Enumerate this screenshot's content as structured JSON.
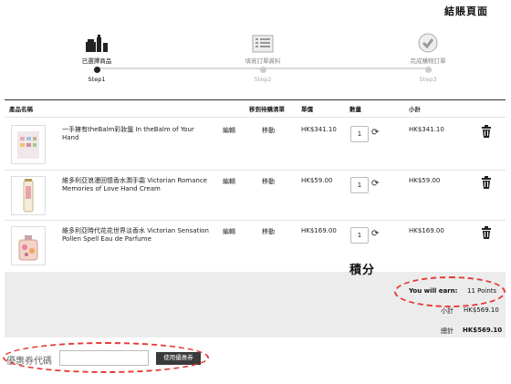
{
  "corner_note": "結賬頁面",
  "steps": [
    {
      "label": "已選擇商品",
      "num": "Step1",
      "icon": "products-icon",
      "active": true
    },
    {
      "label": "填寫訂單資料",
      "num": "Step2",
      "icon": "form-icon",
      "active": false
    },
    {
      "label": "完成購物訂單",
      "num": "Step3",
      "icon": "checkmark-icon",
      "active": false
    }
  ],
  "table": {
    "headers": {
      "name": "產品名稱",
      "wishlist": "移到待購清單",
      "price": "單價",
      "qty": "數量",
      "subtotal": "小計"
    },
    "rows": [
      {
        "name": "一手擁有theBalm彩妝盤 In theBalm of Your Hand",
        "edit": "編輯",
        "move": "移動",
        "price": "HK$341.10",
        "qty": "1",
        "subtotal": "HK$341.10"
      },
      {
        "name": "維多利亞浪漫回憶香水潤手霜 Victorian Romance Memories of Love Hand Cream",
        "edit": "編輯",
        "move": "移動",
        "price": "HK$59.00",
        "qty": "1",
        "subtotal": "HK$59.00"
      },
      {
        "name": "維多利亞時代花花世界淡香水 Victorian Sensation Pollen Spell Eau de Parfume",
        "edit": "編輯",
        "move": "移動",
        "price": "HK$169.00",
        "qty": "1",
        "subtotal": "HK$169.00"
      }
    ]
  },
  "points_note": "積分",
  "summary": {
    "earn_label": "You will earn:",
    "earn_value": "11 Points",
    "subtotal_label": "小計",
    "subtotal_value": "HK$569.10",
    "total_label": "總計",
    "total_value": "HK$569.10"
  },
  "coupon": {
    "label": "優惠券代碼",
    "value": "",
    "button": "使用優惠券"
  },
  "colors": {
    "highlight": "#e53935",
    "button": "#3a3a3a",
    "summary_bg": "#ececec"
  }
}
